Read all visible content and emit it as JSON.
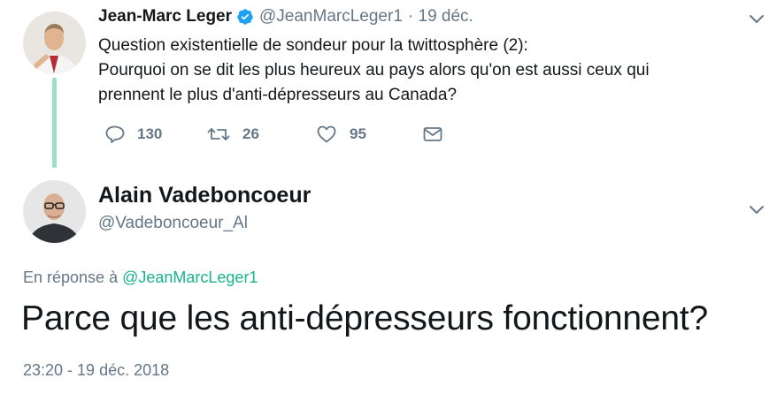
{
  "tweet1": {
    "author_name": "Jean-Marc Leger",
    "handle": "@JeanMarcLeger1",
    "date": "· 19 déc.",
    "text_line1": "Question existentielle de sondeur pour la twittosphère (2):",
    "text_line2": "Pourquoi on se dit les plus heureux au pays alors qu'on est aussi ceux qui",
    "text_line3": "prennent le plus d'anti-dépresseurs au Canada?",
    "replies": "130",
    "retweets": "26",
    "likes": "95"
  },
  "tweet2": {
    "author_name": "Alain Vadeboncoeur",
    "handle": "@Vadeboncoeur_Al",
    "reply_prefix": "En réponse à",
    "reply_to": "@JeanMarcLeger1",
    "text": "Parce que les anti-dépresseurs fonctionnent?",
    "timestamp": "23:20 - 19 déc. 2018"
  },
  "icons": {
    "verified": "verified-badge-icon",
    "reply": "reply-icon",
    "retweet": "retweet-icon",
    "like": "heart-icon",
    "message": "envelope-icon",
    "more": "chevron-down-icon"
  },
  "colors": {
    "accent": "#19b38b",
    "verified": "#1da1f2",
    "secondary_text": "#657786",
    "thread_line": "#9be0c8"
  }
}
